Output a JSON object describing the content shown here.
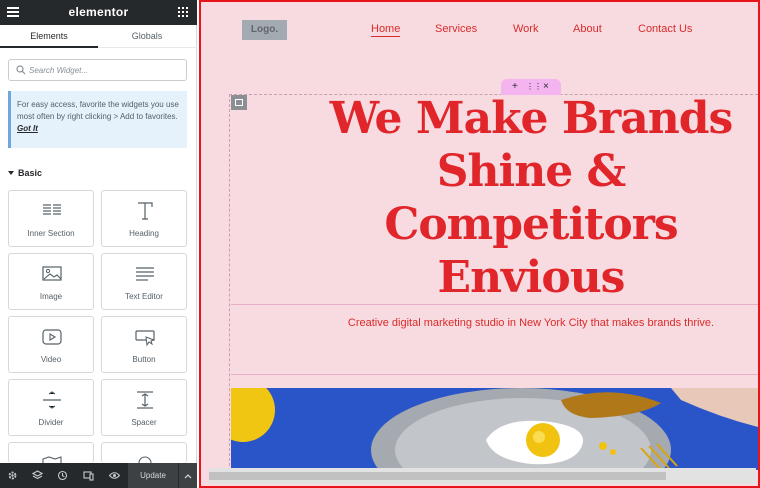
{
  "panel": {
    "brand": "elementor",
    "tabs": [
      "Elements",
      "Globals"
    ],
    "search_placeholder": "Search Widget...",
    "tip_text": "For easy access, favorite the widgets you use most often by right clicking > Add to favorites.",
    "tip_link": "Got It",
    "category": "Basic",
    "widgets": [
      {
        "label": "Inner Section",
        "icon": "inner-section-icon"
      },
      {
        "label": "Heading",
        "icon": "heading-icon"
      },
      {
        "label": "Image",
        "icon": "image-icon"
      },
      {
        "label": "Text Editor",
        "icon": "text-editor-icon"
      },
      {
        "label": "Video",
        "icon": "video-icon"
      },
      {
        "label": "Button",
        "icon": "button-icon"
      },
      {
        "label": "Divider",
        "icon": "divider-icon"
      },
      {
        "label": "Spacer",
        "icon": "spacer-icon"
      }
    ],
    "footer": {
      "icons": [
        "settings-icon",
        "navigator-icon",
        "history-icon",
        "responsive-icon",
        "preview-icon"
      ],
      "update_label": "Update"
    }
  },
  "preview": {
    "logo": "Logo.",
    "nav": [
      "Home",
      "Services",
      "Work",
      "About",
      "Contact Us"
    ],
    "headline": [
      "We Make Brands",
      "Shine &",
      "Competitors",
      "Envious"
    ],
    "subtitle": "Creative digital marketing studio in New York City that makes brands thrive.",
    "section_handle_icons": [
      "+",
      "⋮⋮",
      "×"
    ]
  },
  "colors": {
    "accent_red": "#e0262a",
    "preview_bg": "#f8dbe0",
    "panel_dark": "#26292c",
    "selection_border": "#e8141c"
  }
}
